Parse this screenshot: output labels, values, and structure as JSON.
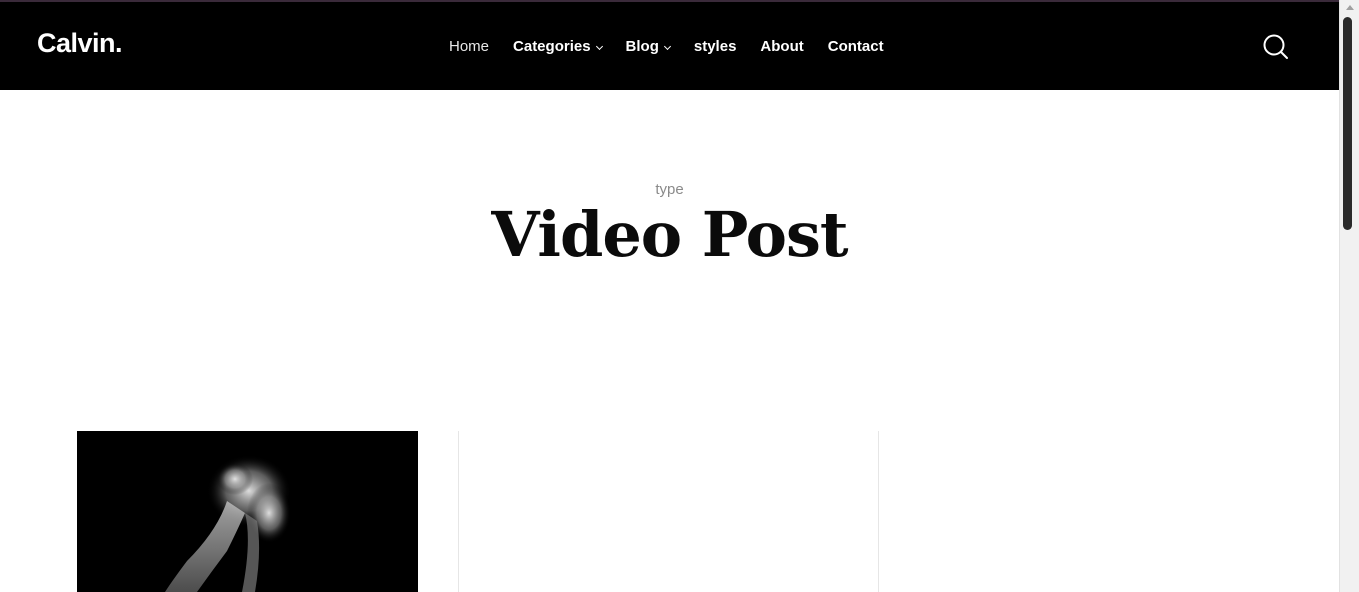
{
  "header": {
    "logo": "Calvin.",
    "nav": [
      {
        "label": "Home",
        "has_dropdown": false
      },
      {
        "label": "Categories",
        "has_dropdown": true
      },
      {
        "label": "Blog",
        "has_dropdown": true
      },
      {
        "label": "styles",
        "has_dropdown": false
      },
      {
        "label": "About",
        "has_dropdown": false
      },
      {
        "label": "Contact",
        "has_dropdown": false
      }
    ],
    "search_icon": "search-icon"
  },
  "hero": {
    "eyebrow": "type",
    "title": "Video Post"
  },
  "colors": {
    "header_bg": "#000000",
    "text_dark": "#0b0b0b",
    "eyebrow": "#8a8a8a"
  }
}
